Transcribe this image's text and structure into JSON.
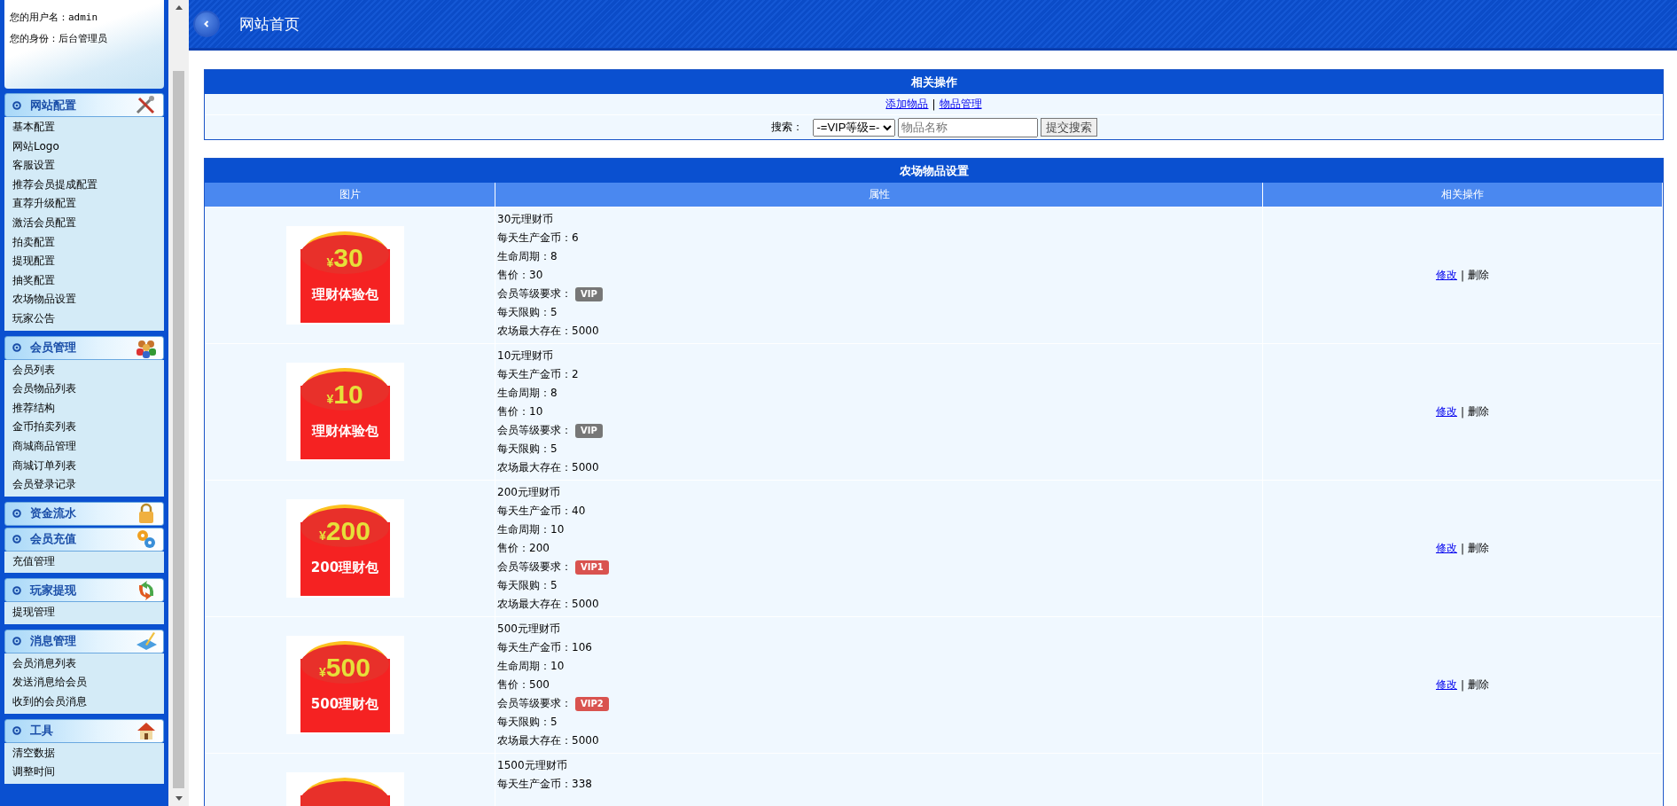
{
  "sidebar": {
    "user": [
      "您的用户名：admin",
      "您的身份：后台管理员"
    ],
    "groups": [
      {
        "title": "网站配置",
        "items": [
          "基本配置",
          "网站Logo",
          "客服设置",
          "推荐会员提成配置",
          "直荐升级配置",
          "激活会员配置",
          "拍卖配置",
          "提现配置",
          "抽奖配置",
          "农场物品设置",
          "玩家公告"
        ]
      },
      {
        "title": "会员管理",
        "items": [
          "会员列表",
          "会员物品列表",
          "推荐结构",
          "金币拍卖列表",
          "商城商品管理",
          "商城订单列表",
          "会员登录记录"
        ]
      },
      {
        "title": "资金流水"
      },
      {
        "title": "会员充值",
        "items": [
          "充值管理"
        ]
      },
      {
        "title": "玩家提现",
        "items": [
          "提现管理"
        ]
      },
      {
        "title": "消息管理",
        "items": [
          "会员消息列表",
          "发送消息给会员",
          "收到的会员消息"
        ]
      },
      {
        "title": "工具",
        "items": [
          "清空数据",
          "调整时间"
        ]
      }
    ]
  },
  "header": {
    "title": "网站首页"
  },
  "actions_panel": {
    "title": "相关操作",
    "links": [
      "添加物品",
      "物品管理"
    ],
    "separator": "|",
    "search": {
      "label": "搜索：",
      "select": "-=VIP等级=-",
      "placeholder": "物品名称",
      "button": "提交搜索"
    }
  },
  "table": {
    "title": "农场物品设置",
    "columns": [
      "图片",
      "属性",
      "相关操作"
    ],
    "separator": "|",
    "rows": [
      {
        "image": {
          "currency": "¥",
          "amount": "30",
          "caption": "理财体验包"
        },
        "name": "30元理财币",
        "fields": [
          {
            "kind": "text",
            "label": "每天生产金币：",
            "value": "6"
          },
          {
            "kind": "text",
            "label": "生命周期：",
            "value": "8"
          },
          {
            "kind": "text",
            "label": "售价：",
            "value": "30"
          },
          {
            "kind": "badge",
            "label": "会员等级要求：",
            "value": "VIP",
            "color": "#777777"
          },
          {
            "kind": "text",
            "label": "每天限购：",
            "value": "5"
          },
          {
            "kind": "text",
            "label": "农场最大存在：",
            "value": "5000"
          }
        ],
        "actions": [
          "修改",
          "删除"
        ]
      },
      {
        "image": {
          "currency": "¥",
          "amount": "10",
          "caption": "理财体验包"
        },
        "name": "10元理财币",
        "fields": [
          {
            "kind": "text",
            "label": "每天生产金币：",
            "value": "2"
          },
          {
            "kind": "text",
            "label": "生命周期：",
            "value": "8"
          },
          {
            "kind": "text",
            "label": "售价：",
            "value": "10"
          },
          {
            "kind": "badge",
            "label": "会员等级要求：",
            "value": "VIP",
            "color": "#777777"
          },
          {
            "kind": "text",
            "label": "每天限购：",
            "value": "5"
          },
          {
            "kind": "text",
            "label": "农场最大存在：",
            "value": "5000"
          }
        ],
        "actions": [
          "修改",
          "删除"
        ]
      },
      {
        "image": {
          "currency": "¥",
          "amount": "200",
          "caption": "200理财包"
        },
        "name": "200元理财币",
        "fields": [
          {
            "kind": "text",
            "label": "每天生产金币：",
            "value": "40"
          },
          {
            "kind": "text",
            "label": "生命周期：",
            "value": "10"
          },
          {
            "kind": "text",
            "label": "售价：",
            "value": "200"
          },
          {
            "kind": "badge",
            "label": "会员等级要求：",
            "value": "VIP1",
            "color": "#d9534f"
          },
          {
            "kind": "text",
            "label": "每天限购：",
            "value": "5"
          },
          {
            "kind": "text",
            "label": "农场最大存在：",
            "value": "5000"
          }
        ],
        "actions": [
          "修改",
          "删除"
        ]
      },
      {
        "image": {
          "currency": "¥",
          "amount": "500",
          "caption": "500理财包"
        },
        "name": "500元理财币",
        "fields": [
          {
            "kind": "text",
            "label": "每天生产金币：",
            "value": "106"
          },
          {
            "kind": "text",
            "label": "生命周期：",
            "value": "10"
          },
          {
            "kind": "text",
            "label": "售价：",
            "value": "500"
          },
          {
            "kind": "badge",
            "label": "会员等级要求：",
            "value": "VIP2",
            "color": "#d9534f"
          },
          {
            "kind": "text",
            "label": "每天限购：",
            "value": "5"
          },
          {
            "kind": "text",
            "label": "农场最大存在：",
            "value": "5000"
          }
        ],
        "actions": [
          "修改",
          "删除"
        ]
      },
      {
        "image": {},
        "name": "1500元理财币",
        "fields": [
          {
            "kind": "text",
            "label": "每天生产金币：",
            "value": "338"
          }
        ],
        "actions": []
      }
    ]
  }
}
